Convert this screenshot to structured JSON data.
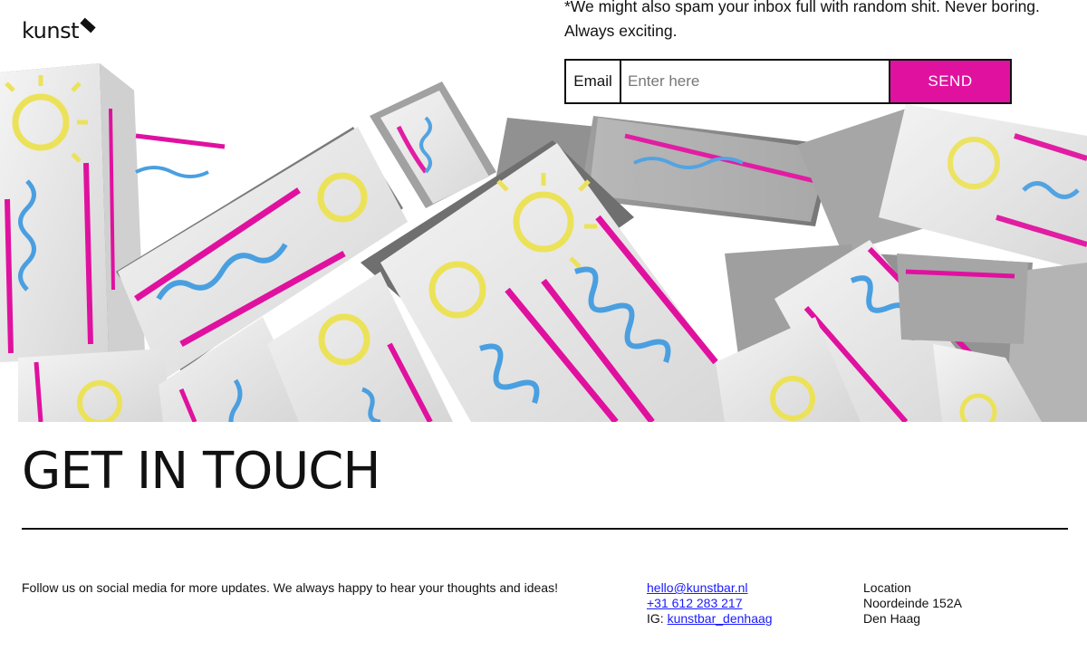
{
  "header": {
    "logo_text": "kunst"
  },
  "newsletter": {
    "note_line1": "*We might also spam your inbox full with random shit. Never boring.",
    "note_line2": "Always exciting.",
    "email_label": "Email",
    "email_placeholder": "Enter here",
    "send_label": "SEND"
  },
  "hero": {
    "image_icon": "stacked-boxes-illustration",
    "colors": {
      "magenta": "#e0119f",
      "blue": "#4a9fe0",
      "yellow": "#ece25a",
      "box_grey": "#a8a8a8"
    }
  },
  "contact": {
    "title": "GET IN TOUCH",
    "follow_text": "Follow us on social media for more updates. We always happy to hear your thoughts and ideas!",
    "email": "hello@kunstbar.nl",
    "phone": "+31 612 283 217",
    "ig_label": "IG: ",
    "ig_handle": "kunstbar_denhaag",
    "location_label": "Location",
    "address_line1": "Noordeinde 152A",
    "address_line2": "Den Haag"
  },
  "colors": {
    "accent": "#e0119f",
    "link": "#1a1aff",
    "text": "#111111"
  }
}
